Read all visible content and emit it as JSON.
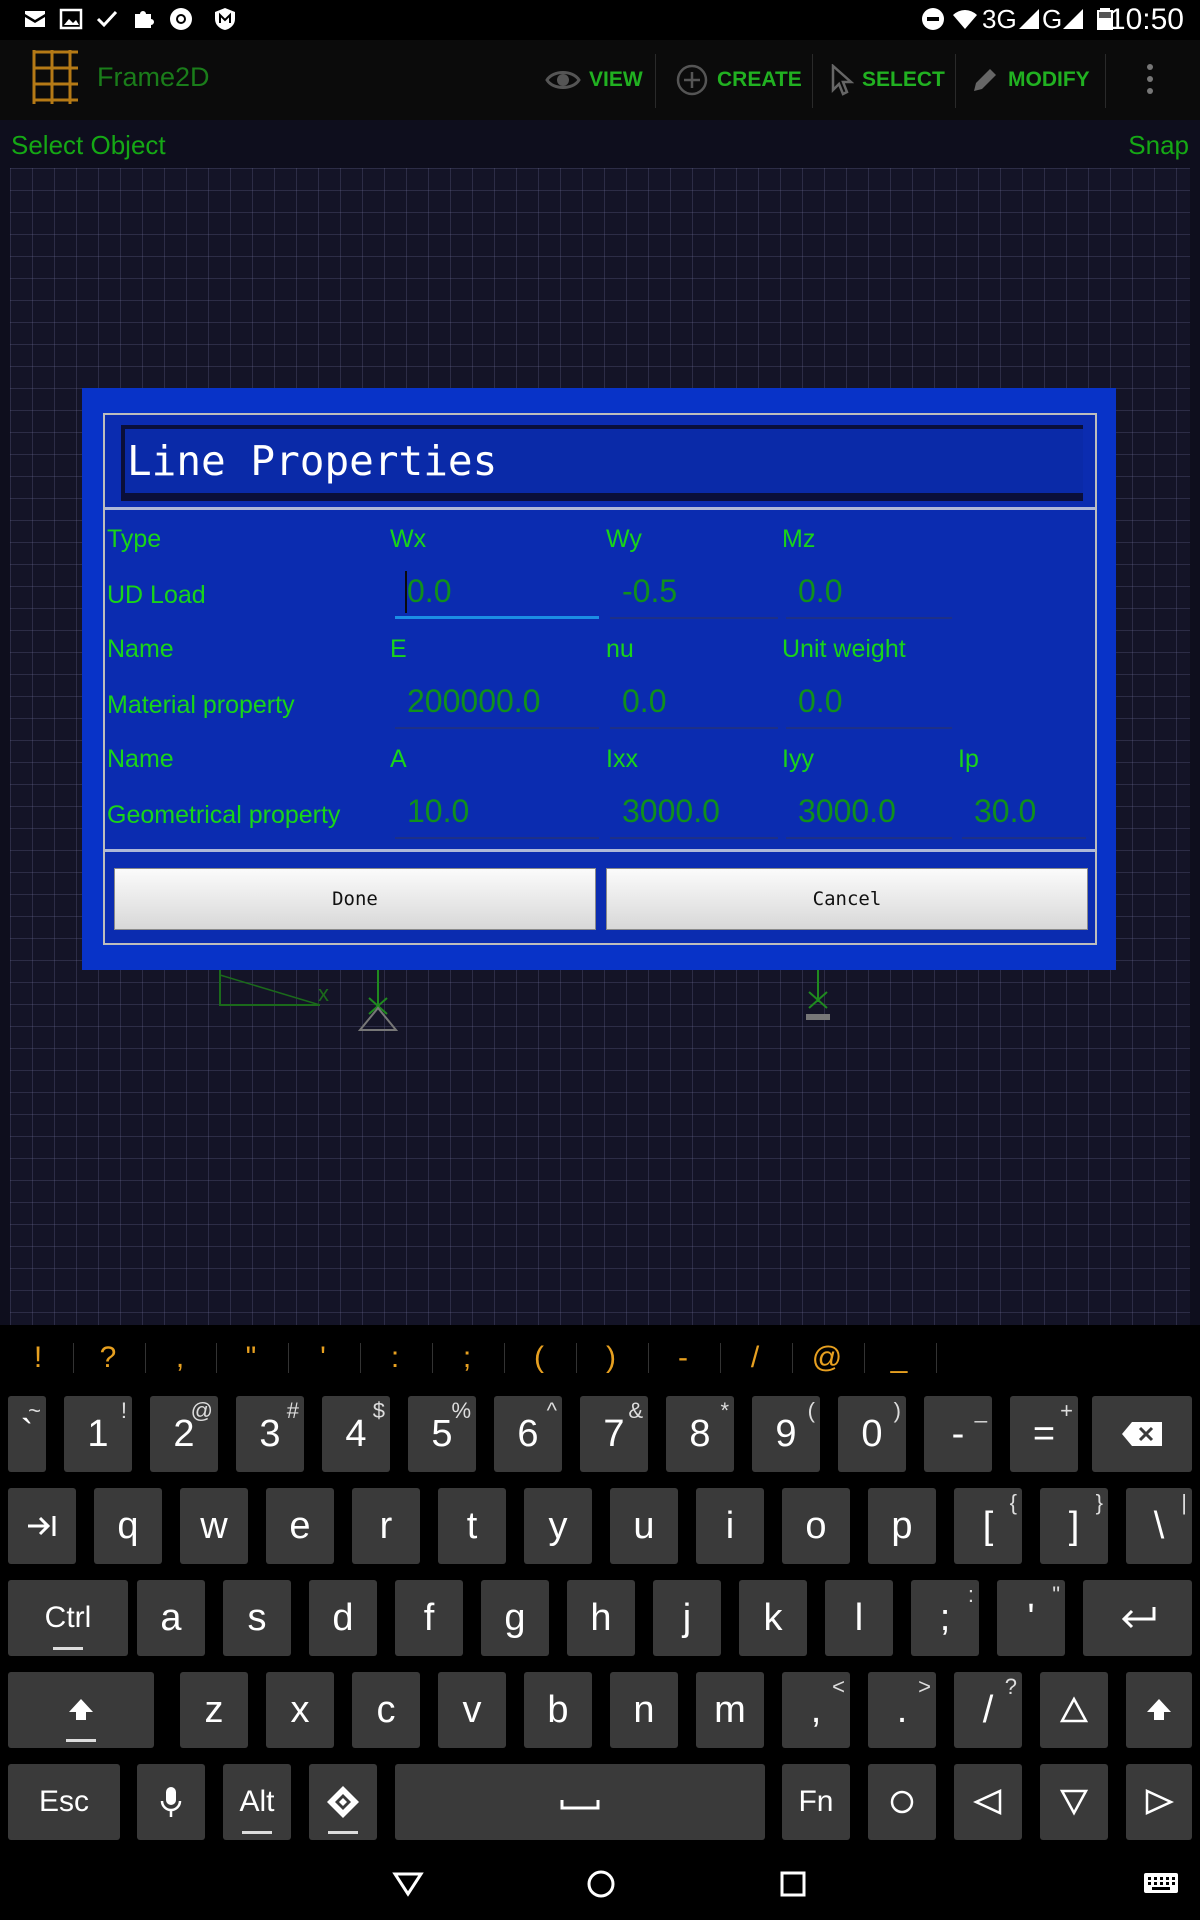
{
  "status_bar": {
    "time": "10:50",
    "net_3g": "3G",
    "net_g": "G"
  },
  "app": {
    "title": "Frame2D"
  },
  "menu": [
    {
      "label": "VIEW",
      "icon": "eye-icon"
    },
    {
      "label": "CREATE",
      "icon": "plus-circle-icon"
    },
    {
      "label": "SELECT",
      "icon": "cursor-icon"
    },
    {
      "label": "MODIFY",
      "icon": "pencil-icon"
    }
  ],
  "canvas": {
    "hint": "Select Object",
    "snap": "Snap",
    "axis_label": "x"
  },
  "dialog": {
    "title": "Line Properties",
    "rows": [
      {
        "label": "Type",
        "cols": [
          "Wx",
          "Wy",
          "Mz",
          ""
        ]
      },
      {
        "label": "UD Load",
        "values": [
          "0.0",
          "-0.5",
          "0.0"
        ]
      },
      {
        "label": "Name",
        "cols": [
          "E",
          "nu",
          "Unit weight",
          ""
        ]
      },
      {
        "label": "Material property",
        "values": [
          "200000.0",
          "0.0",
          "0.0"
        ]
      },
      {
        "label": "Name",
        "cols": [
          "A",
          "Ixx",
          "Iyy",
          "Ip"
        ]
      },
      {
        "label": "Geometrical property",
        "values": [
          "10.0",
          "3000.0",
          "3000.0",
          "30.0"
        ]
      }
    ],
    "done_label": "Done",
    "cancel_label": "Cancel"
  },
  "suggestions": [
    "!",
    "?",
    ",",
    "\"",
    "'",
    ":",
    ";",
    "(",
    ")",
    "-",
    "/",
    "@",
    "_"
  ],
  "keyboard": {
    "row1": [
      {
        "m": "`",
        "s": "~"
      },
      {
        "m": "1",
        "s": "!"
      },
      {
        "m": "2",
        "s": "@"
      },
      {
        "m": "3",
        "s": "#"
      },
      {
        "m": "4",
        "s": "$"
      },
      {
        "m": "5",
        "s": "%"
      },
      {
        "m": "6",
        "s": "^"
      },
      {
        "m": "7",
        "s": "&"
      },
      {
        "m": "8",
        "s": "*"
      },
      {
        "m": "9",
        "s": "("
      },
      {
        "m": "0",
        "s": ")"
      },
      {
        "m": "-",
        "s": "_"
      },
      {
        "m": "=",
        "s": "+"
      }
    ],
    "row2": [
      "q",
      "w",
      "e",
      "r",
      "t",
      "y",
      "u",
      "i",
      "o",
      "p"
    ],
    "row2_extra": [
      {
        "m": "[",
        "s": "{"
      },
      {
        "m": "]",
        "s": "}"
      },
      {
        "m": "\\",
        "s": "|"
      }
    ],
    "row3": [
      "a",
      "s",
      "d",
      "f",
      "g",
      "h",
      "j",
      "k",
      "l"
    ],
    "row3_extra": [
      {
        "m": ";",
        "s": ":"
      },
      {
        "m": "'",
        "s": "\""
      }
    ],
    "ctrl": "Ctrl",
    "row4": [
      "z",
      "x",
      "c",
      "v",
      "b",
      "n",
      "m"
    ],
    "row4_extra": [
      {
        "m": ",",
        "s": "<"
      },
      {
        "m": ".",
        "s": ">"
      },
      {
        "m": "/",
        "s": "?"
      }
    ],
    "esc": "Esc",
    "alt": "Alt",
    "fn": "Fn"
  },
  "colors": {
    "dialog_bg": "#0b2cb0",
    "label_green": "#19d419",
    "value_green": "#10901c",
    "accent_orange": "#e7a020"
  }
}
